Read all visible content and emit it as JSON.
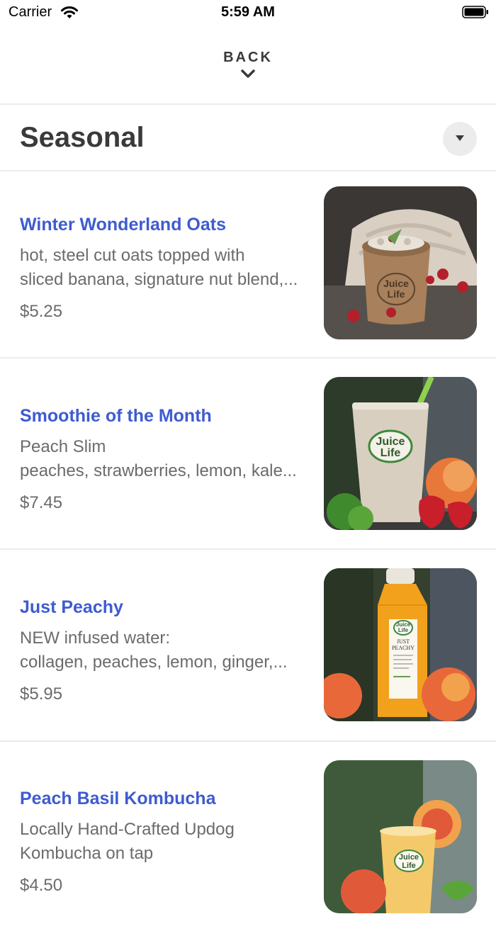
{
  "status_bar": {
    "carrier": "Carrier",
    "time": "5:59 AM"
  },
  "header": {
    "back_label": "BACK"
  },
  "section": {
    "title": "Seasonal"
  },
  "items": [
    {
      "name": "Winter Wonderland Oats",
      "desc_line1": "hot, steel cut oats topped with",
      "desc_line2": "sliced banana, signature nut blend,...",
      "price": "$5.25",
      "image": {
        "logo_line1": "Juice",
        "logo_line2": "Life"
      }
    },
    {
      "name": "Smoothie of the Month",
      "desc_line1": "Peach Slim",
      "desc_line2": "peaches, strawberries, lemon, kale...",
      "price": "$7.45",
      "image": {
        "logo_line1": "Juice",
        "logo_line2": "Life"
      }
    },
    {
      "name": "Just Peachy",
      "desc_line1": "NEW infused water:",
      "desc_line2": "collagen, peaches, lemon, ginger,...",
      "price": "$5.95",
      "image": {
        "logo_line1": "Juice",
        "logo_line2": "Life",
        "label_line1": "JUST",
        "label_line2": "PEACHY"
      }
    },
    {
      "name": "Peach Basil Kombucha",
      "desc_line1": "Locally Hand-Crafted Updog",
      "desc_line2": "Kombucha on tap",
      "price": "$4.50",
      "image": {
        "logo_line1": "Juice",
        "logo_line2": "Life"
      }
    }
  ],
  "colors": {
    "accent": "#3f5bd0",
    "text": "#3a3a3a",
    "muted": "#6b6b6b",
    "divider": "#ececec"
  },
  "icons": {
    "wifi": "wifi-icon",
    "battery": "battery-icon",
    "back": "chevron-down-icon",
    "dropdown": "caret-down-icon"
  }
}
